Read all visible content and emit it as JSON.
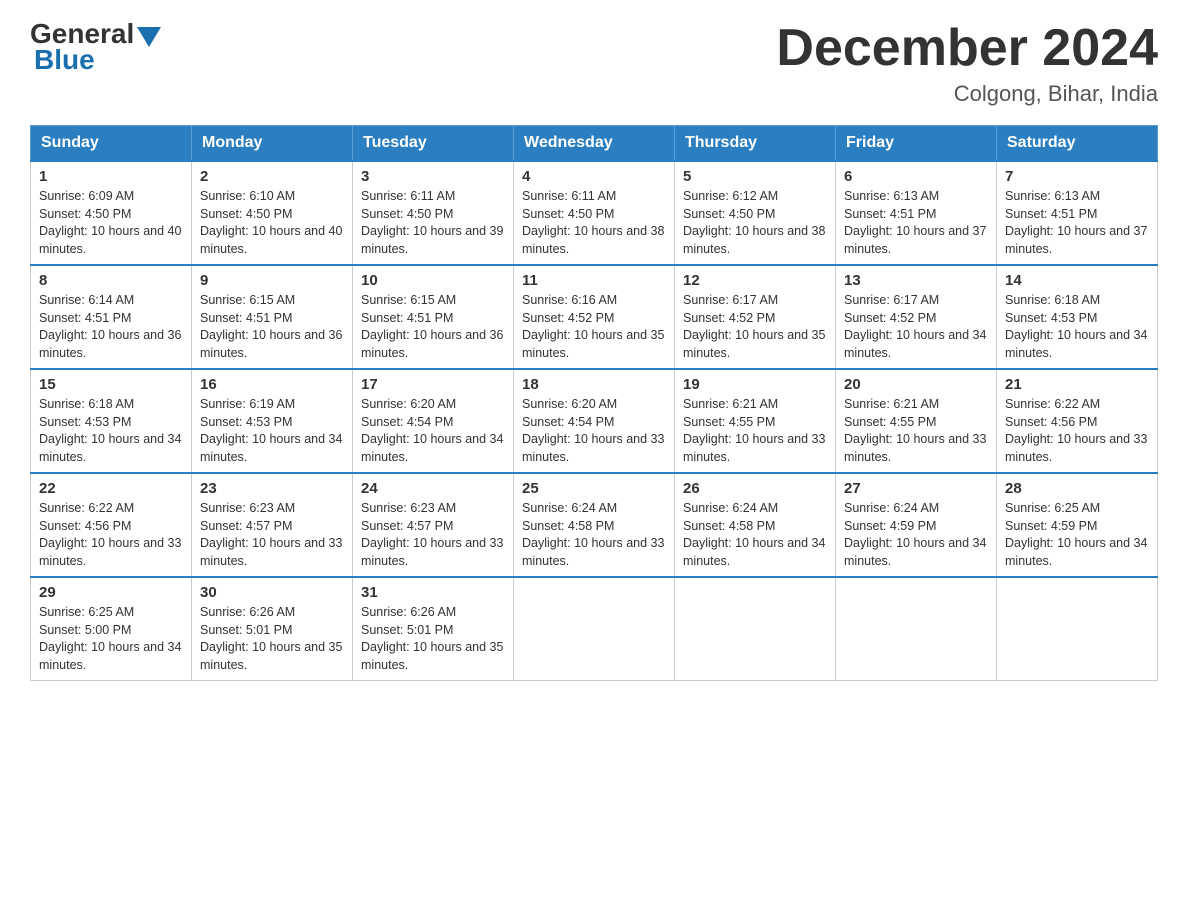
{
  "header": {
    "logo": {
      "general": "General",
      "blue": "Blue"
    },
    "title": "December 2024",
    "location": "Colgong, Bihar, India"
  },
  "columns": [
    "Sunday",
    "Monday",
    "Tuesday",
    "Wednesday",
    "Thursday",
    "Friday",
    "Saturday"
  ],
  "weeks": [
    [
      {
        "day": "1",
        "sunrise": "6:09 AM",
        "sunset": "4:50 PM",
        "daylight": "10 hours and 40 minutes."
      },
      {
        "day": "2",
        "sunrise": "6:10 AM",
        "sunset": "4:50 PM",
        "daylight": "10 hours and 40 minutes."
      },
      {
        "day": "3",
        "sunrise": "6:11 AM",
        "sunset": "4:50 PM",
        "daylight": "10 hours and 39 minutes."
      },
      {
        "day": "4",
        "sunrise": "6:11 AM",
        "sunset": "4:50 PM",
        "daylight": "10 hours and 38 minutes."
      },
      {
        "day": "5",
        "sunrise": "6:12 AM",
        "sunset": "4:50 PM",
        "daylight": "10 hours and 38 minutes."
      },
      {
        "day": "6",
        "sunrise": "6:13 AM",
        "sunset": "4:51 PM",
        "daylight": "10 hours and 37 minutes."
      },
      {
        "day": "7",
        "sunrise": "6:13 AM",
        "sunset": "4:51 PM",
        "daylight": "10 hours and 37 minutes."
      }
    ],
    [
      {
        "day": "8",
        "sunrise": "6:14 AM",
        "sunset": "4:51 PM",
        "daylight": "10 hours and 36 minutes."
      },
      {
        "day": "9",
        "sunrise": "6:15 AM",
        "sunset": "4:51 PM",
        "daylight": "10 hours and 36 minutes."
      },
      {
        "day": "10",
        "sunrise": "6:15 AM",
        "sunset": "4:51 PM",
        "daylight": "10 hours and 36 minutes."
      },
      {
        "day": "11",
        "sunrise": "6:16 AM",
        "sunset": "4:52 PM",
        "daylight": "10 hours and 35 minutes."
      },
      {
        "day": "12",
        "sunrise": "6:17 AM",
        "sunset": "4:52 PM",
        "daylight": "10 hours and 35 minutes."
      },
      {
        "day": "13",
        "sunrise": "6:17 AM",
        "sunset": "4:52 PM",
        "daylight": "10 hours and 34 minutes."
      },
      {
        "day": "14",
        "sunrise": "6:18 AM",
        "sunset": "4:53 PM",
        "daylight": "10 hours and 34 minutes."
      }
    ],
    [
      {
        "day": "15",
        "sunrise": "6:18 AM",
        "sunset": "4:53 PM",
        "daylight": "10 hours and 34 minutes."
      },
      {
        "day": "16",
        "sunrise": "6:19 AM",
        "sunset": "4:53 PM",
        "daylight": "10 hours and 34 minutes."
      },
      {
        "day": "17",
        "sunrise": "6:20 AM",
        "sunset": "4:54 PM",
        "daylight": "10 hours and 34 minutes."
      },
      {
        "day": "18",
        "sunrise": "6:20 AM",
        "sunset": "4:54 PM",
        "daylight": "10 hours and 33 minutes."
      },
      {
        "day": "19",
        "sunrise": "6:21 AM",
        "sunset": "4:55 PM",
        "daylight": "10 hours and 33 minutes."
      },
      {
        "day": "20",
        "sunrise": "6:21 AM",
        "sunset": "4:55 PM",
        "daylight": "10 hours and 33 minutes."
      },
      {
        "day": "21",
        "sunrise": "6:22 AM",
        "sunset": "4:56 PM",
        "daylight": "10 hours and 33 minutes."
      }
    ],
    [
      {
        "day": "22",
        "sunrise": "6:22 AM",
        "sunset": "4:56 PM",
        "daylight": "10 hours and 33 minutes."
      },
      {
        "day": "23",
        "sunrise": "6:23 AM",
        "sunset": "4:57 PM",
        "daylight": "10 hours and 33 minutes."
      },
      {
        "day": "24",
        "sunrise": "6:23 AM",
        "sunset": "4:57 PM",
        "daylight": "10 hours and 33 minutes."
      },
      {
        "day": "25",
        "sunrise": "6:24 AM",
        "sunset": "4:58 PM",
        "daylight": "10 hours and 33 minutes."
      },
      {
        "day": "26",
        "sunrise": "6:24 AM",
        "sunset": "4:58 PM",
        "daylight": "10 hours and 34 minutes."
      },
      {
        "day": "27",
        "sunrise": "6:24 AM",
        "sunset": "4:59 PM",
        "daylight": "10 hours and 34 minutes."
      },
      {
        "day": "28",
        "sunrise": "6:25 AM",
        "sunset": "4:59 PM",
        "daylight": "10 hours and 34 minutes."
      }
    ],
    [
      {
        "day": "29",
        "sunrise": "6:25 AM",
        "sunset": "5:00 PM",
        "daylight": "10 hours and 34 minutes."
      },
      {
        "day": "30",
        "sunrise": "6:26 AM",
        "sunset": "5:01 PM",
        "daylight": "10 hours and 35 minutes."
      },
      {
        "day": "31",
        "sunrise": "6:26 AM",
        "sunset": "5:01 PM",
        "daylight": "10 hours and 35 minutes."
      },
      null,
      null,
      null,
      null
    ]
  ]
}
